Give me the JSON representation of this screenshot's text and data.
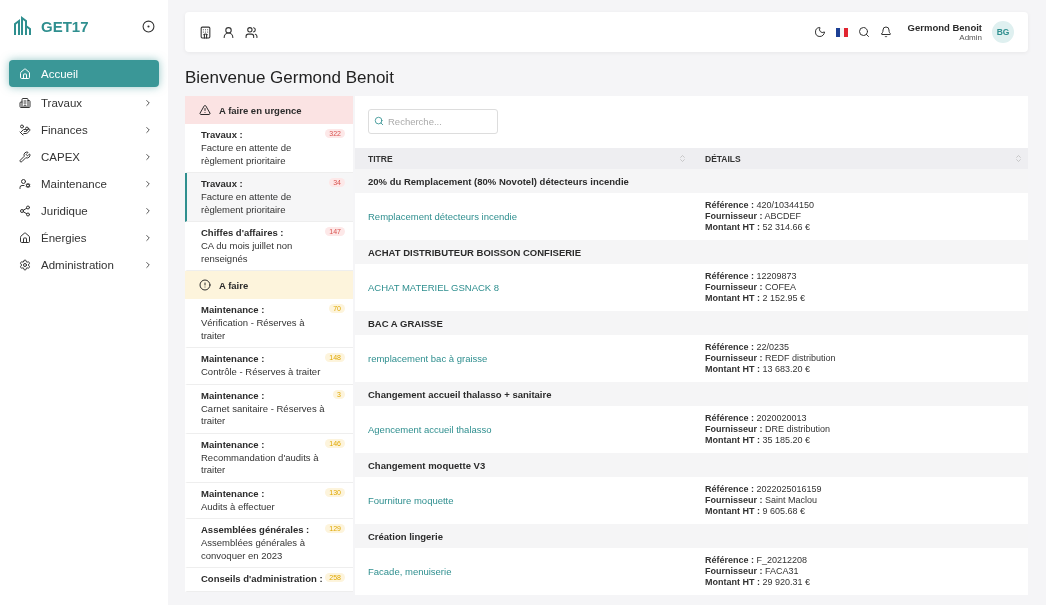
{
  "brand": {
    "name": "GET17"
  },
  "sidebar": {
    "items": [
      {
        "label": "Accueil",
        "selected": true,
        "has_submenu": false
      },
      {
        "label": "Travaux",
        "selected": false,
        "has_submenu": true
      },
      {
        "label": "Finances",
        "selected": false,
        "has_submenu": true
      },
      {
        "label": "CAPEX",
        "selected": false,
        "has_submenu": true
      },
      {
        "label": "Maintenance",
        "selected": false,
        "has_submenu": true
      },
      {
        "label": "Juridique",
        "selected": false,
        "has_submenu": true
      },
      {
        "label": "Énergies",
        "selected": false,
        "has_submenu": true
      },
      {
        "label": "Administration",
        "selected": false,
        "has_submenu": true
      }
    ]
  },
  "topbar": {
    "user": {
      "name": "Germond Benoit",
      "role": "Admin",
      "initials": "BG"
    }
  },
  "heading": "Bienvenue Germond Benoit",
  "tasks": [
    {
      "kind": "urgent",
      "title": "A faire en urgence",
      "items": [
        {
          "title": "Travaux :",
          "description": "Facture en attente de règlement prioritaire",
          "count": "322",
          "selected": false
        },
        {
          "title": "Travaux :",
          "description": "Facture en attente de règlement prioritaire",
          "count": "34",
          "selected": true
        },
        {
          "title": "Chiffes d'affaires :",
          "description": "CA du mois juillet non renseignés",
          "count": "147",
          "selected": false
        }
      ]
    },
    {
      "kind": "todo",
      "title": "A faire",
      "items": [
        {
          "title": "Maintenance :",
          "description": "Vérification - Réserves à traiter",
          "count": "70",
          "selected": false
        },
        {
          "title": "Maintenance :",
          "description": "Contrôle - Réserves à traiter",
          "count": "148",
          "selected": false
        },
        {
          "title": "Maintenance :",
          "description": "Carnet sanitaire - Réserves à traiter",
          "count": "3",
          "selected": false
        },
        {
          "title": "Maintenance :",
          "description": "Recommandation d'audits à traiter",
          "count": "146",
          "selected": false
        },
        {
          "title": "Maintenance :",
          "description": "Audits à effectuer",
          "count": "130",
          "selected": false
        },
        {
          "title": "Assemblées générales :",
          "description": "Assemblées générales à convoquer en 2023",
          "count": "129",
          "selected": false
        },
        {
          "title": "Conseils d'administration :",
          "count": "258",
          "selected": false
        }
      ]
    }
  ],
  "search": {
    "placeholder": "Recherche..."
  },
  "table": {
    "columns": [
      "TITRE",
      "DÉTAILS"
    ],
    "groups": [
      {
        "title": "20% du Remplacement (80% Novotel) détecteurs incendie",
        "rows": [
          {
            "title": "Remplacement détecteurs incendie",
            "details": [
              "**Référence :** 420/10344150",
              "**Fournisseur :** ABCDEF",
              "**Montant HT :** 52 314.66 €"
            ]
          }
        ]
      },
      {
        "title": "ACHAT DISTRIBUTEUR BOISSON CONFISERIE",
        "rows": [
          {
            "title": "ACHAT MATERIEL GSNACK 8",
            "details": [
              "**Référence :** 12209873",
              "**Fournisseur :** COFEA",
              "**Montant HT :** 2 152.95 €"
            ]
          }
        ]
      },
      {
        "title": "BAC A GRAISSE",
        "rows": [
          {
            "title": "remplacement bac à graisse",
            "details": [
              "**Référence :** 22/0235",
              "**Fournisseur :** REDF distribution",
              "**Montant HT :** 13 683.20 €"
            ]
          }
        ]
      },
      {
        "title": "Changement accueil thalasso + sanitaire",
        "rows": [
          {
            "title": "Agencement accueil thalasso",
            "details": [
              "**Référence :** 2020020013",
              "**Fournisseur :** DRE distribution",
              "**Montant HT :** 35 185.20 €"
            ]
          }
        ]
      },
      {
        "title": "Changement moquette V3",
        "rows": [
          {
            "title": "Fourniture moquette",
            "details": [
              "**Référence :** 2022025016159",
              "**Fournisseur :** Saint Maclou",
              "**Montant HT :** 9 605.68 €"
            ]
          }
        ]
      },
      {
        "title": "Création lingerie",
        "rows": [
          {
            "title": "Facade, menuiserie",
            "details": [
              "**Référence :** F_20212208",
              "**Fournisseur :** FACA31",
              "**Montant HT :** 29 920.31 €"
            ]
          }
        ]
      }
    ]
  }
}
